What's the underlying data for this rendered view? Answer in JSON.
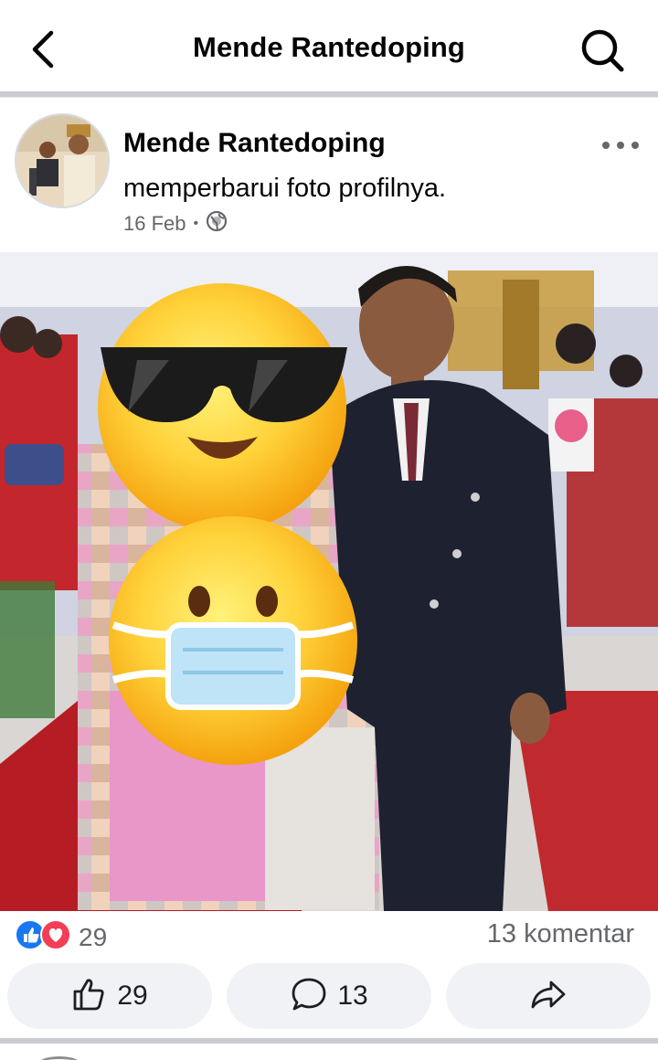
{
  "header": {
    "title": "Mende Rantedoping"
  },
  "post": {
    "author": "Mende Rantedoping",
    "action": "memperbarui foto profilnya.",
    "date": "16 Feb",
    "privacy_icon": "globe-icon",
    "more_icon": "more-horizontal-icon"
  },
  "photo": {
    "stickers": [
      "sunglasses-emoji",
      "mask-emoji"
    ]
  },
  "stats": {
    "reaction_icons": [
      "like-reaction-icon",
      "love-reaction-icon"
    ],
    "reaction_count": "29",
    "comments_label": "13 komentar"
  },
  "actions": {
    "like_count": "29",
    "comment_count": "13",
    "share_icon": "share-icon"
  },
  "colors": {
    "like_blue": "#1877f2",
    "love_red": "#f33e58",
    "button_bg": "#f0f2f5",
    "divider": "#c9ccd1"
  }
}
